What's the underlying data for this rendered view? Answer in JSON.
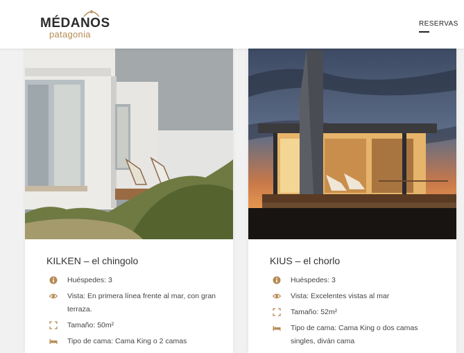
{
  "header": {
    "logo_title": "MÉDANOS",
    "logo_subtitle": "patagonia",
    "nav_reservas": "RESERVAS"
  },
  "accent_color": "#b58a54",
  "cards": [
    {
      "title": "KILKEN – el chingolo",
      "features": [
        {
          "icon": "info-icon",
          "text": "Huéspedes: 3"
        },
        {
          "icon": "eye-icon",
          "text": "Vista: En primera línea frente al mar, con gran terraza."
        },
        {
          "icon": "expand-icon",
          "text": "Tamaño: 50m²"
        },
        {
          "icon": "bed-icon",
          "text": "Tipo de cama: Cama King o 2 camas"
        }
      ]
    },
    {
      "title": "KIUS – el chorlo",
      "features": [
        {
          "icon": "info-icon",
          "text": "Huéspedes: 3"
        },
        {
          "icon": "eye-icon",
          "text": "Vista: Excelentes vistas al mar"
        },
        {
          "icon": "expand-icon",
          "text": "Tamaño: 52m²"
        },
        {
          "icon": "bed-icon",
          "text": "Tipo de cama: Cama King o dos camas singles, diván cama"
        }
      ]
    }
  ]
}
